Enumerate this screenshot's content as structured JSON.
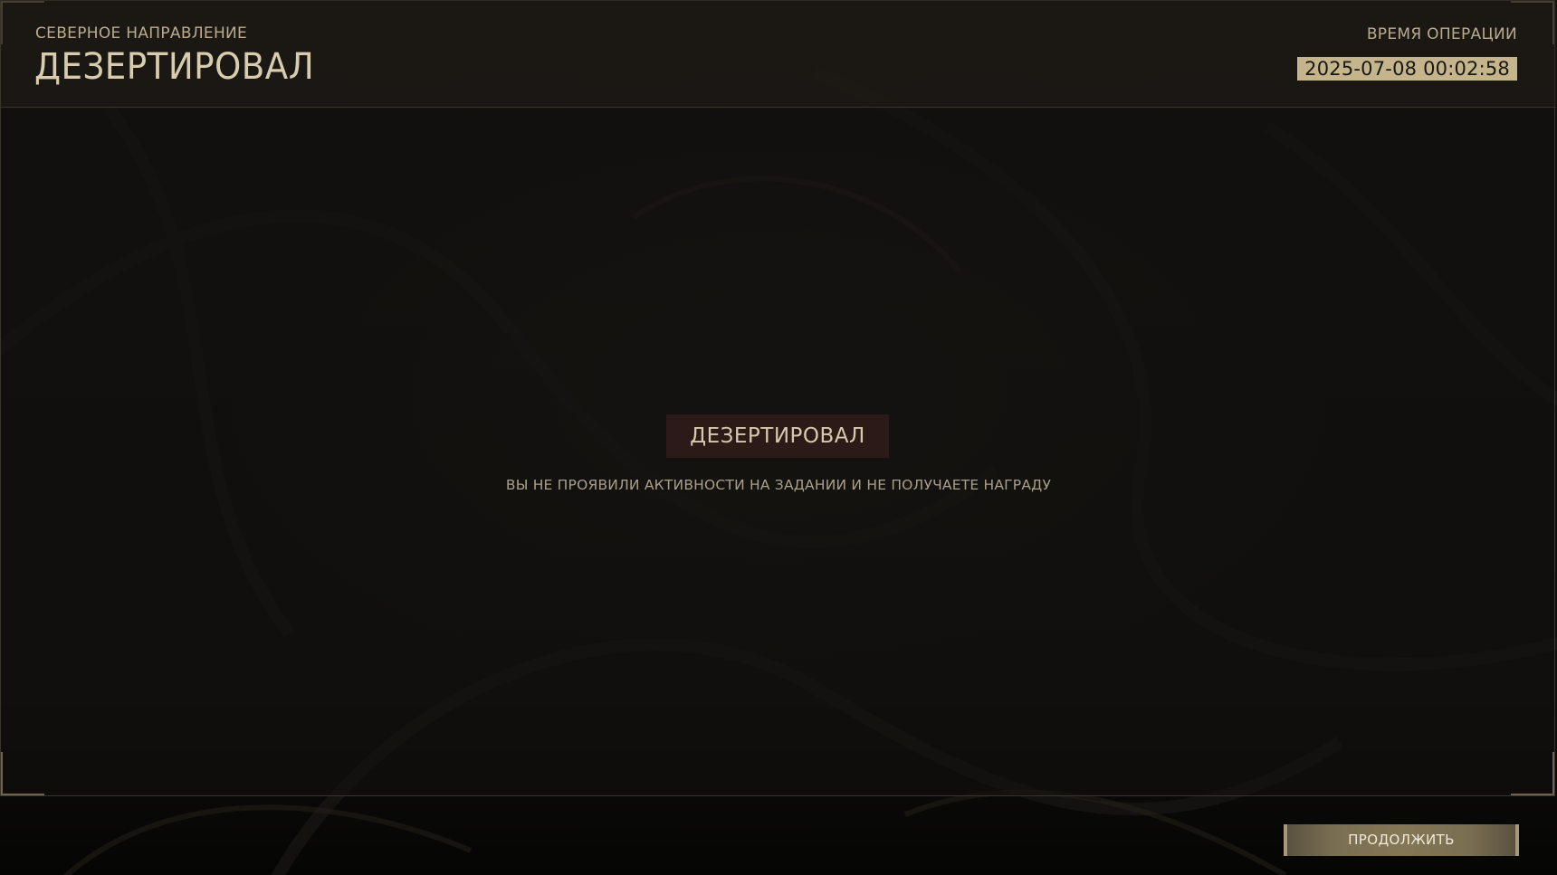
{
  "header": {
    "direction_label": "СЕВЕРНОЕ НАПРАВЛЕНИЕ",
    "title": "ДЕЗЕРТИРОВАЛ",
    "operation_time_label": "ВРЕМЯ ОПЕРАЦИИ",
    "operation_time_value": "2025-07-08 00:02:58"
  },
  "result": {
    "status": "ДЕЗЕРТИРОВАЛ",
    "message": "ВЫ НЕ ПРОЯВИЛИ АКТИВНОСТИ НА ЗАДАНИИ И НЕ ПОЛУЧАЕТЕ НАГРАДУ"
  },
  "footer": {
    "continue_label": "ПРОДОЛЖИТЬ"
  },
  "colors": {
    "accent_gold": "#c4b58c",
    "text_primary": "#d8ccae",
    "status_badge_bg": "#2b1a17",
    "panel_border": "#3a352a"
  }
}
